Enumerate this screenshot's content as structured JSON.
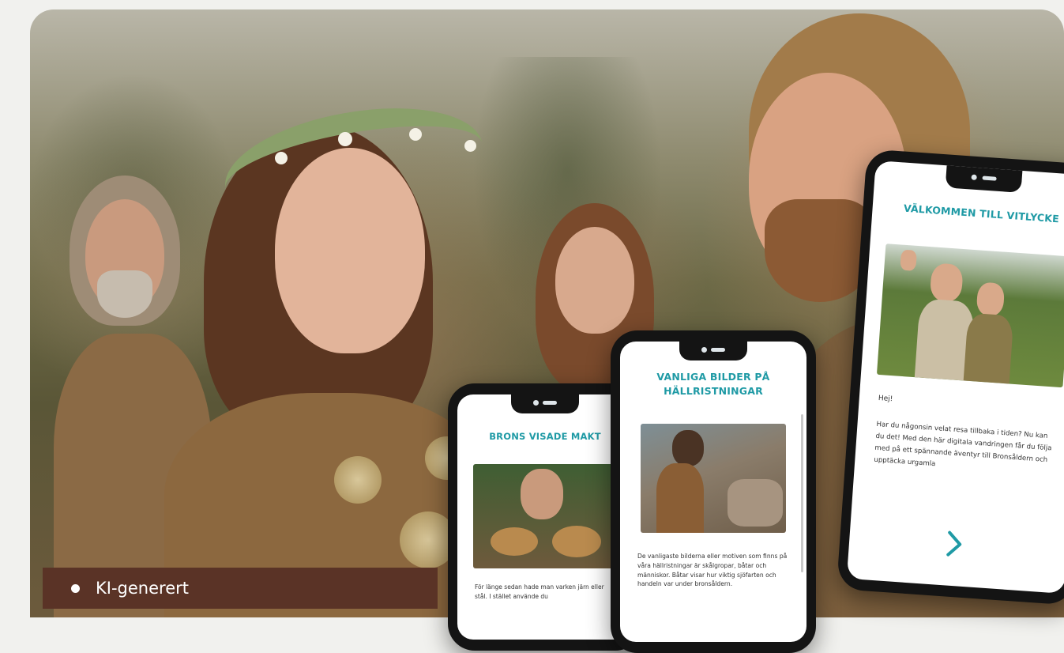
{
  "badge": {
    "label": "KI-generert"
  },
  "phone_small": {
    "title": "BRONS VISADE MAKT",
    "body": "För länge sedan hade man varken järn eller stål. I stället använde du"
  },
  "phone_mid": {
    "title": "VANLIGA BILDER PÅ HÄLLRISTNINGAR",
    "body": "De vanligaste bilderna eller motiven som finns på våra hällristningar är skålgropar, båtar och människor. Båtar visar hur viktig sjöfarten och handeln var under bronsåldern."
  },
  "phone_large": {
    "title": "VÄLKOMMEN TILL VITLYCKE",
    "greeting": "Hej!",
    "body": "Har du någonsin velat resa tillbaka i tiden? Nu kan du det! Med den här digitala vandringen får du följa med på ett spännande äventyr till Bronsåldern och upptäcka urgamla",
    "next_icon": "chevron-right-icon"
  },
  "colors": {
    "accent": "#1f9aa5",
    "badge_bg": "#5a3326"
  }
}
